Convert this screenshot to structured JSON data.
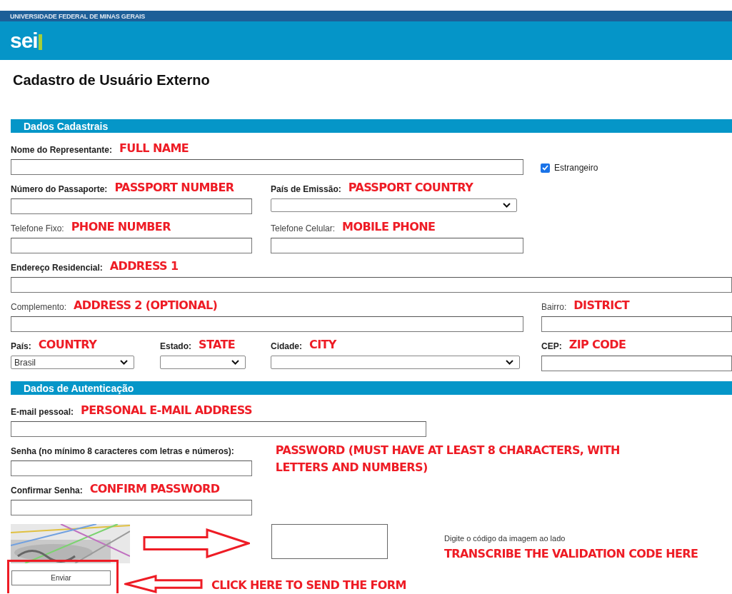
{
  "header": {
    "institution": "UNIVERSIDADE FEDERAL DE MINAS GERAIS",
    "logo": "sei"
  },
  "page_title": "Cadastro de Usuário Externo",
  "sections": [
    {
      "title": "Dados Cadastrais",
      "rows": [
        [
          {
            "kind": "input",
            "label": "Nome do Representante:",
            "required": true,
            "annotation": "FULL NAME"
          },
          {
            "kind": "checkbox",
            "label": "Estrangeiro",
            "checked": true
          }
        ],
        [
          {
            "kind": "input",
            "label": "Número do Passaporte:",
            "required": true,
            "annotation": "PASSPORT NUMBER"
          },
          {
            "kind": "select",
            "label": "País de Emissão:",
            "required": true,
            "annotation": "PASSPORT COUNTRY"
          }
        ],
        [
          {
            "kind": "input",
            "label": "Telefone Fixo:",
            "required": false,
            "annotation": "PHONE NUMBER"
          },
          {
            "kind": "input",
            "label": "Telefone Celular:",
            "required": false,
            "annotation": "MOBILE PHONE"
          }
        ],
        [
          {
            "kind": "input",
            "label": "Endereço Residencial:",
            "required": true,
            "annotation": "ADDRESS 1"
          }
        ],
        [
          {
            "kind": "input",
            "label": "Complemento:",
            "required": false,
            "annotation": "ADDRESS 2 (OPTIONAL)"
          },
          {
            "kind": "input",
            "label": "Bairro:",
            "required": false,
            "annotation": "DISTRICT"
          }
        ],
        [
          {
            "kind": "select",
            "label": "País:",
            "required": true,
            "annotation": "COUNTRY",
            "value": "Brasil"
          },
          {
            "kind": "select",
            "label": "Estado:",
            "required": true,
            "annotation": "STATE"
          },
          {
            "kind": "select",
            "label": "Cidade:",
            "required": true,
            "annotation": "CITY"
          },
          {
            "kind": "input",
            "label": "CEP:",
            "required": true,
            "annotation": "ZIP CODE"
          }
        ]
      ]
    },
    {
      "title": "Dados de Autenticação",
      "rows": [
        [
          {
            "kind": "input",
            "label": "E-mail pessoal:",
            "required": true,
            "annotation": "PERSONAL E-MAIL ADDRESS"
          }
        ],
        [
          {
            "kind": "input",
            "label": "Senha (no mínimo 8 caracteres com letras e números):",
            "required": true,
            "annotation": "PASSWORD (MUST HAVE AT LEAST 8 CHARACTERS, WITH LETTERS AND NUMBERS)"
          }
        ],
        [
          {
            "kind": "input",
            "label": "Confirmar Senha:",
            "required": true,
            "annotation": "CONFIRM PASSWORD"
          }
        ]
      ]
    }
  ],
  "captcha": {
    "hint": "Digite o código da imagem ao lado",
    "annotation": "TRANSCRIBE THE VALIDATION CODE HERE"
  },
  "submit": {
    "label": "Enviar",
    "annotation": "CLICK HERE TO SEND THE FORM"
  }
}
